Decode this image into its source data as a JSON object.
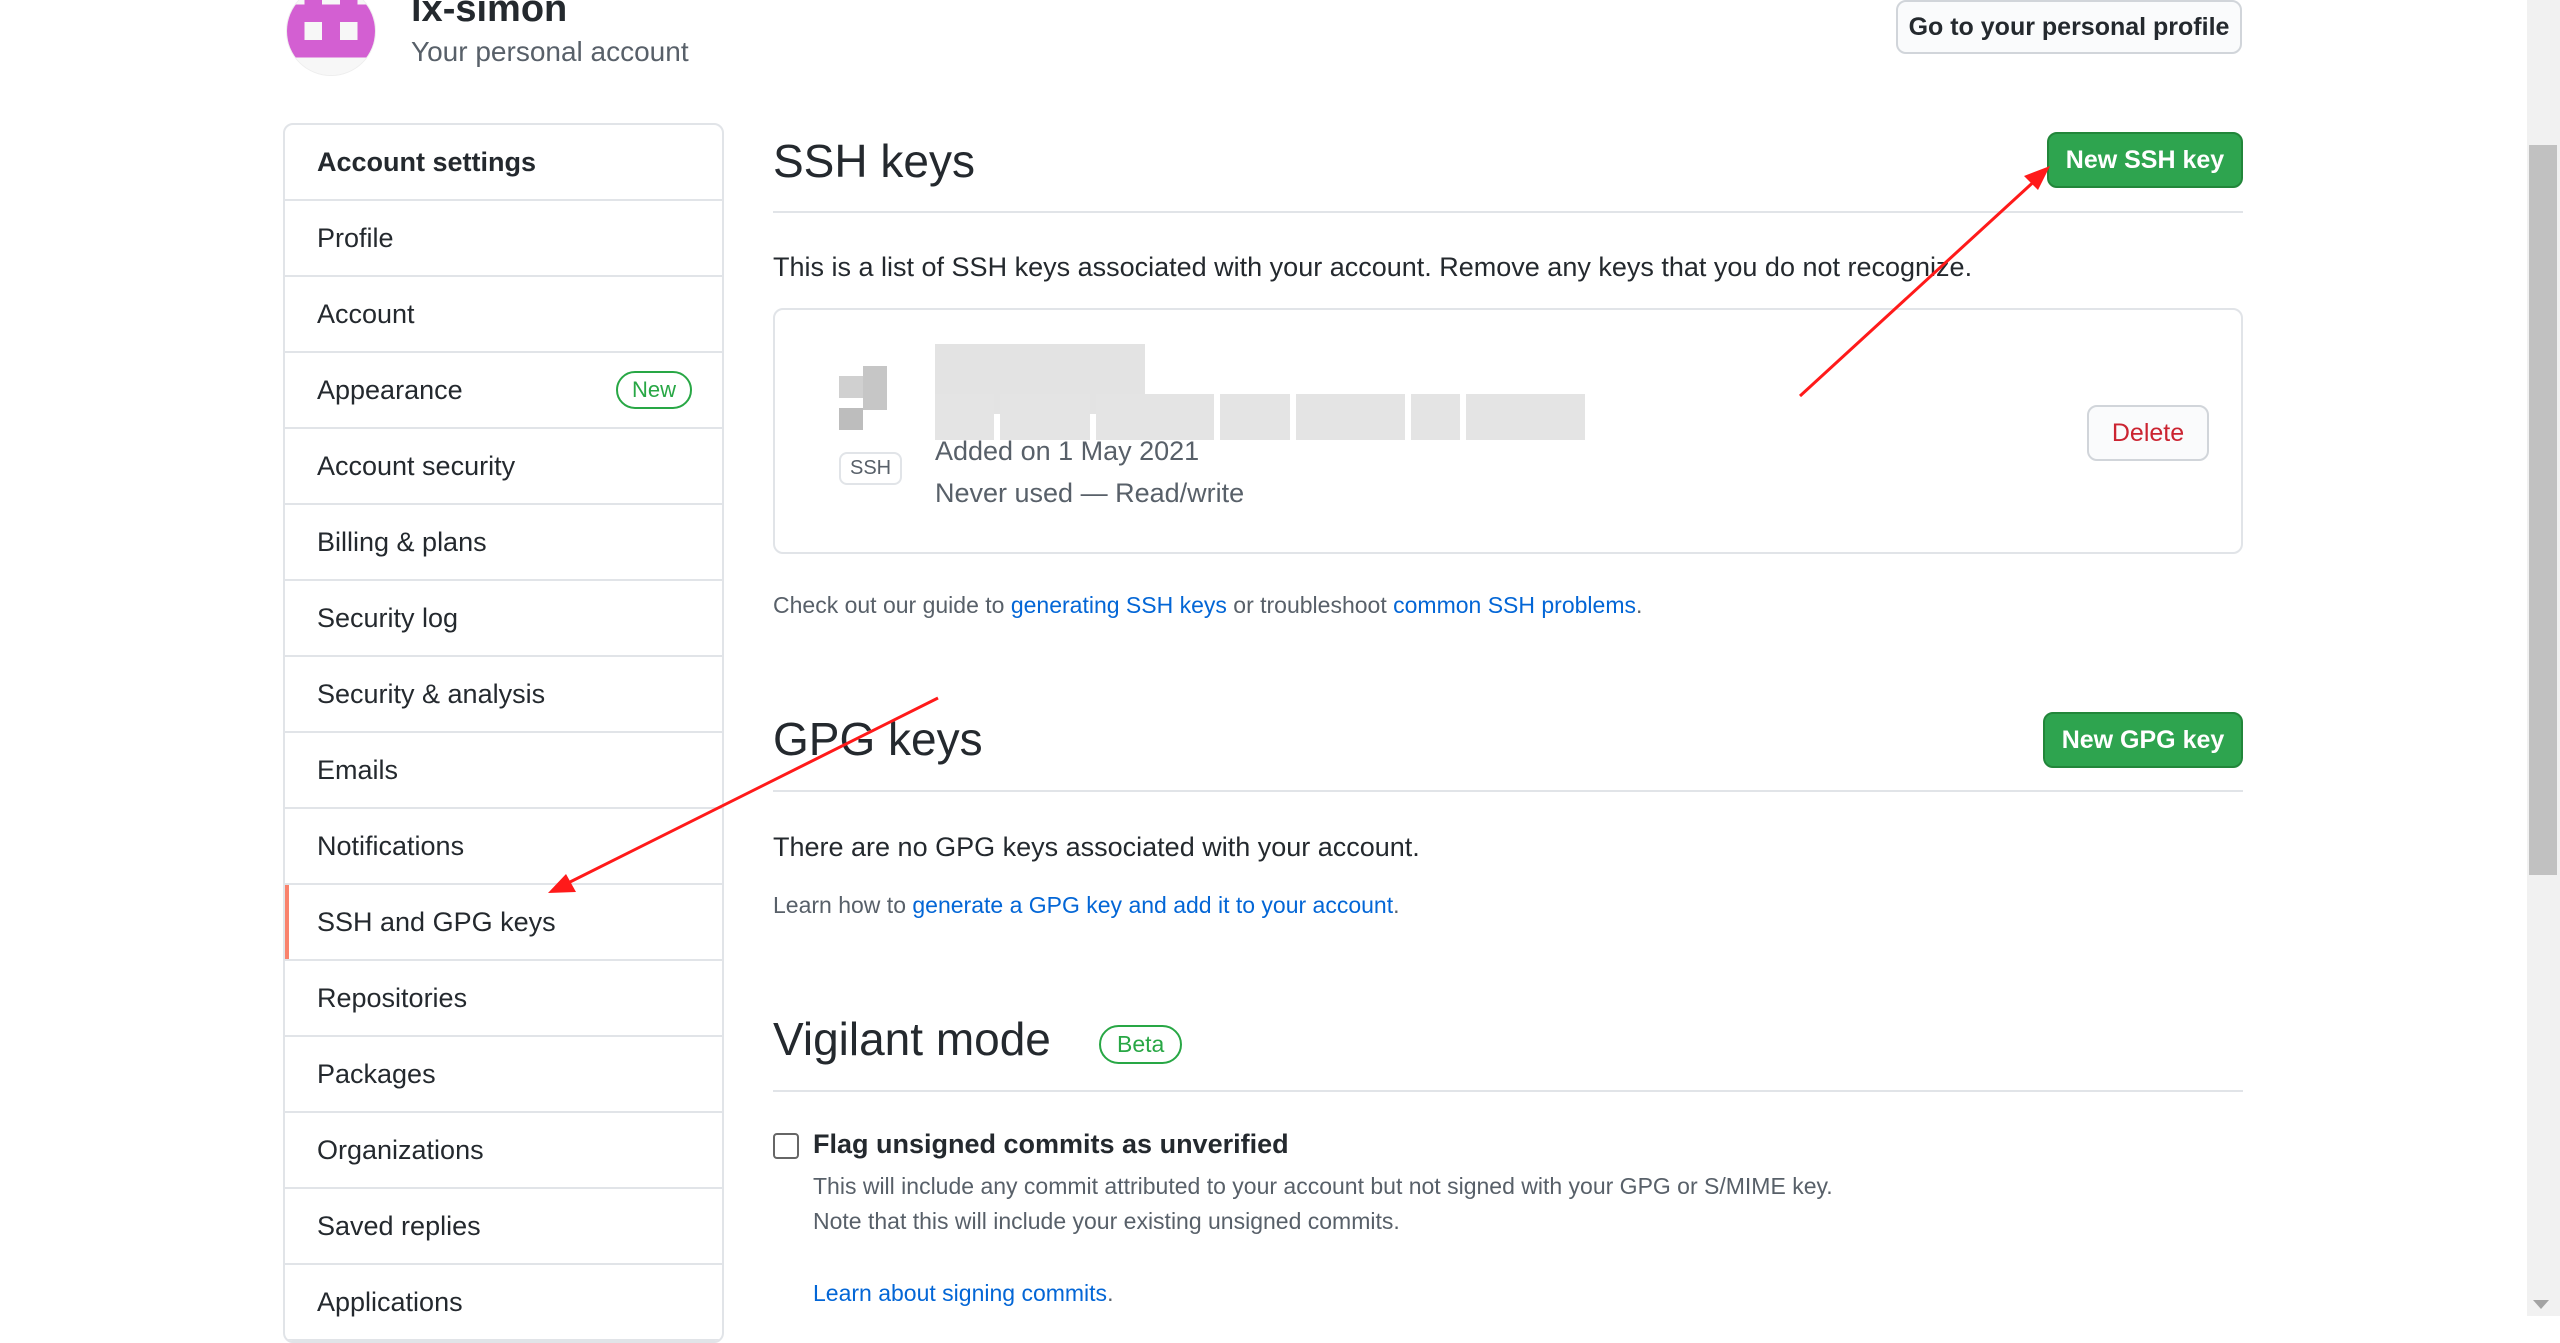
{
  "header": {
    "username": "lx-simon",
    "subtitle": "Your personal account",
    "profile_button": "Go to your personal profile"
  },
  "sidebar": {
    "title": "Account settings",
    "items": [
      {
        "label": "Profile"
      },
      {
        "label": "Account"
      },
      {
        "label": "Appearance",
        "badge": "New"
      },
      {
        "label": "Account security"
      },
      {
        "label": "Billing & plans"
      },
      {
        "label": "Security log"
      },
      {
        "label": "Security & analysis"
      },
      {
        "label": "Emails"
      },
      {
        "label": "Notifications"
      },
      {
        "label": "SSH and GPG keys",
        "selected": true
      },
      {
        "label": "Repositories"
      },
      {
        "label": "Packages"
      },
      {
        "label": "Organizations"
      },
      {
        "label": "Saved replies"
      },
      {
        "label": "Applications"
      }
    ]
  },
  "ssh": {
    "title": "SSH keys",
    "new_button": "New SSH key",
    "description": "This is a list of SSH keys associated with your account. Remove any keys that you do not recognize.",
    "key": {
      "badge": "SSH",
      "added": "Added on 1 May 2021",
      "usage": "Never used — Read/write",
      "delete_label": "Delete"
    },
    "guide": {
      "prefix": "Check out our guide to ",
      "link1": "generating SSH keys",
      "middle": " or troubleshoot ",
      "link2": "common SSH problems",
      "suffix": "."
    }
  },
  "gpg": {
    "title": "GPG keys",
    "new_button": "New GPG key",
    "empty_text": "There are no GPG keys associated with your account.",
    "learn_prefix": "Learn how to ",
    "learn_link": "generate a GPG key and add it to your account",
    "learn_suffix": "."
  },
  "vigilant": {
    "title": "Vigilant mode",
    "badge": "Beta",
    "checkbox_label": "Flag unsigned commits as unverified",
    "checked": false,
    "desc1": "This will include any commit attributed to your account but not signed with your GPG or S/MIME key.",
    "desc2": "Note that this will include your existing unsigned commits.",
    "learn_link": "Learn about signing commits",
    "learn_suffix": "."
  },
  "colors": {
    "primary_green": "#2ea44f",
    "link_blue": "#0366d6",
    "danger_red": "#cb2431",
    "selected_accent": "#f9826c",
    "annotation_red": "#ff1a1a"
  }
}
